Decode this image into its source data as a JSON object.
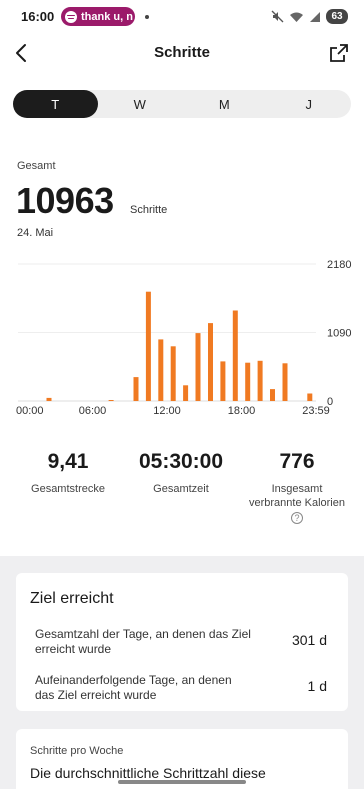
{
  "status_bar": {
    "time": "16:00",
    "media_text": "thank u, n",
    "battery": "63"
  },
  "header": {
    "title": "Schritte"
  },
  "tabs": [
    {
      "label": "T",
      "active": true
    },
    {
      "label": "W",
      "active": false
    },
    {
      "label": "M",
      "active": false
    },
    {
      "label": "J",
      "active": false
    }
  ],
  "summary": {
    "label": "Gesamt",
    "value": "10963",
    "unit": "Schritte",
    "date": "24. Mai"
  },
  "chart_data": {
    "type": "bar",
    "color": "#f07a22",
    "x_tick_labels": [
      "00:00",
      "06:00",
      "12:00",
      "18:00",
      "23:59"
    ],
    "y_tick_labels": [
      "2180",
      "1090",
      "0"
    ],
    "ylim": [
      0,
      2180
    ],
    "grid": true,
    "bars": [
      {
        "hour": 2,
        "value": 50
      },
      {
        "hour": 7,
        "value": 10
      },
      {
        "hour": 9,
        "value": 380
      },
      {
        "hour": 10,
        "value": 1740
      },
      {
        "hour": 11,
        "value": 980
      },
      {
        "hour": 12,
        "value": 870
      },
      {
        "hour": 13,
        "value": 250
      },
      {
        "hour": 14,
        "value": 1080
      },
      {
        "hour": 15,
        "value": 1240
      },
      {
        "hour": 16,
        "value": 630
      },
      {
        "hour": 17,
        "value": 1440
      },
      {
        "hour": 18,
        "value": 610
      },
      {
        "hour": 19,
        "value": 640
      },
      {
        "hour": 20,
        "value": 190
      },
      {
        "hour": 21,
        "value": 600
      },
      {
        "hour": 23,
        "value": 120
      }
    ]
  },
  "stats": {
    "distance_value": "9,41",
    "distance_label": "Gesamtstrecke",
    "time_value": "05:30:00",
    "time_label": "Gesamtzeit",
    "calories_value": "776",
    "calories_label_line1": "Insgesamt",
    "calories_label_line2": "verbrannte Kalorien"
  },
  "goal_card": {
    "title": "Ziel erreicht",
    "row1_line1": "Gesamtzahl der Tage, an denen das Ziel",
    "row1_line2": "erreicht wurde",
    "row1_value": "301 d",
    "row2_line1": "Aufeinanderfolgende Tage, an denen",
    "row2_line2": "das Ziel erreicht wurde",
    "row2_value": "1 d"
  },
  "week_card": {
    "label": "Schritte pro Woche",
    "subtitle": "Die durchschnittliche Schrittzahl diese"
  }
}
